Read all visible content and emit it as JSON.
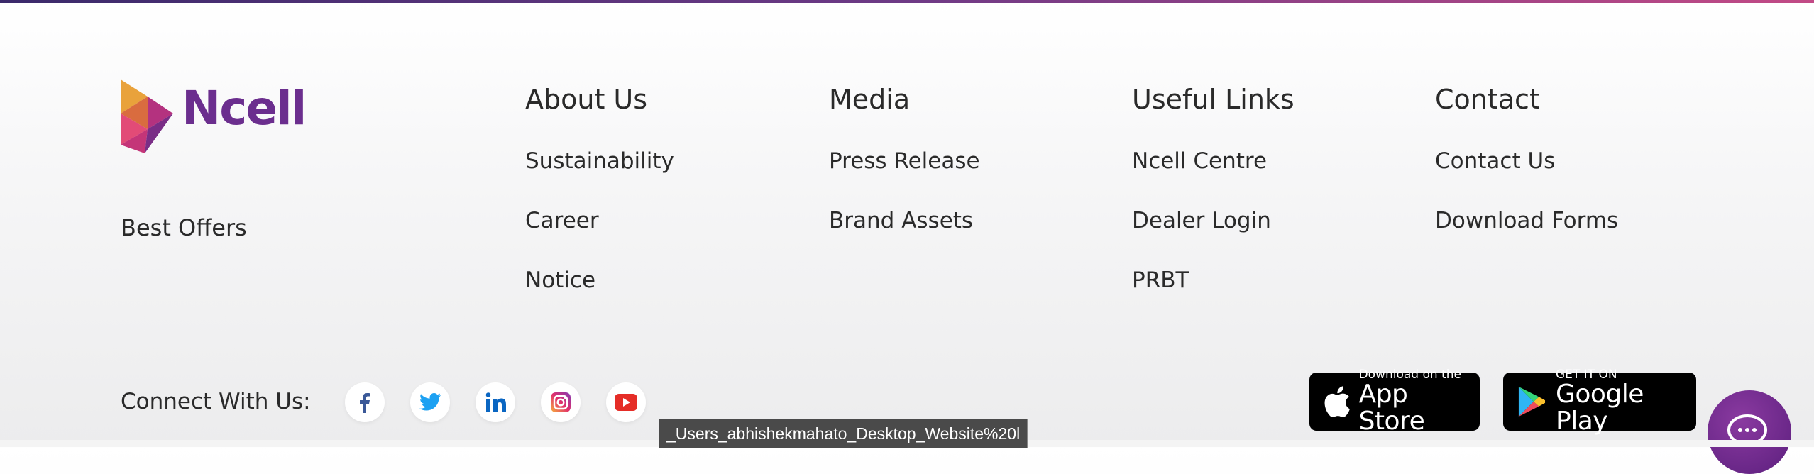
{
  "brand": {
    "name": "Ncell",
    "color": "#6b2e8e"
  },
  "best_offers": "Best Offers",
  "columns": [
    {
      "title": "About Us",
      "links": [
        "Sustainability",
        "Career",
        "Notice"
      ]
    },
    {
      "title": "Media",
      "links": [
        "Press Release",
        "Brand Assets"
      ]
    },
    {
      "title": "Useful Links",
      "links": [
        "Ncell Centre",
        "Dealer Login",
        "PRBT"
      ]
    },
    {
      "title": "Contact",
      "links": [
        "Contact Us",
        "Download Forms"
      ]
    }
  ],
  "connect": {
    "label": "Connect With Us:",
    "icons": [
      "facebook-icon",
      "twitter-icon",
      "linkedin-icon",
      "instagram-icon",
      "youtube-icon"
    ]
  },
  "stores": {
    "apple": {
      "small": "Download on the",
      "big": "App Store"
    },
    "google": {
      "small": "GET IT ON",
      "big": "Google Play"
    }
  },
  "chat_icon": "chat-bubble-icon",
  "tooltip": "_Users_abhishekmahato_Desktop_Website%20l",
  "colors": {
    "accent_start": "#3b2a6b",
    "accent_end": "#c24a86",
    "facebook": "#3b5998",
    "twitter": "#1da1f2",
    "linkedin": "#0a66c2",
    "youtube": "#e52d27"
  }
}
